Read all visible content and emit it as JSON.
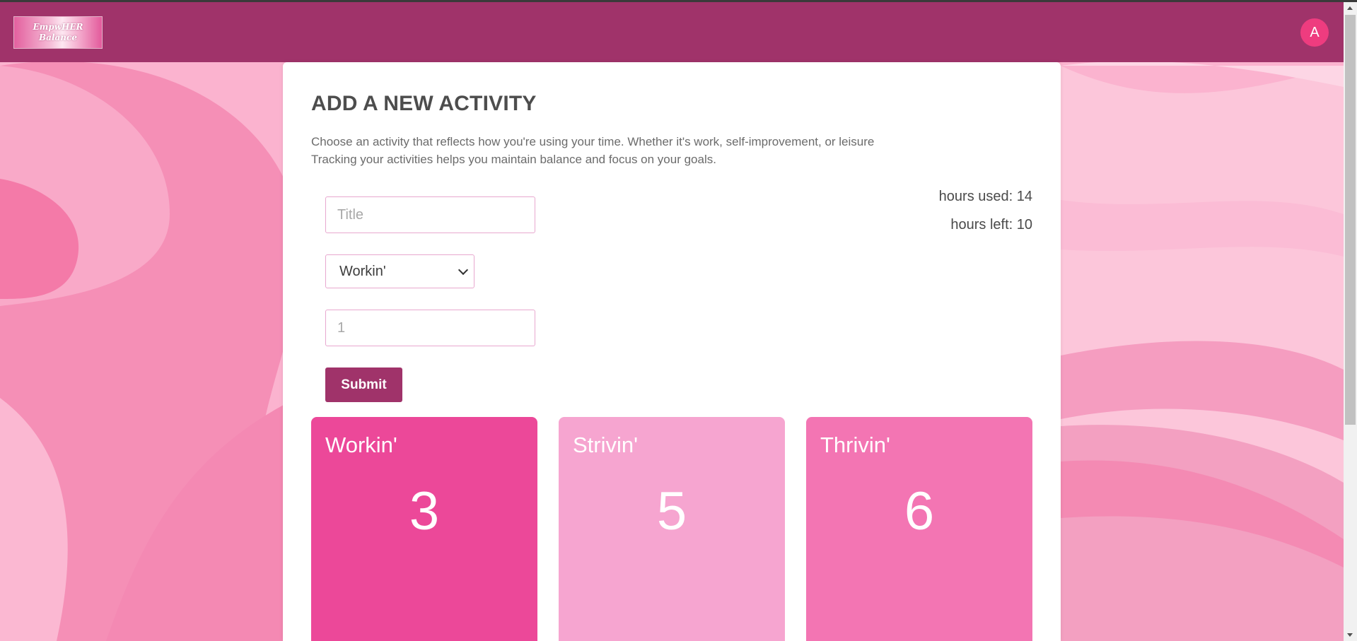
{
  "app": {
    "logo_line1": "EmpwHER",
    "logo_line2": "Balance",
    "avatar_initial": "A",
    "colors": {
      "navbar": "#a0336a",
      "accent": "#ee3c7f",
      "workin_tile": "#ec4899",
      "strivin_tile": "#f6a5d0",
      "thrivin_tile": "#f375b3"
    }
  },
  "form": {
    "title": "ADD A NEW ACTIVITY",
    "description_line1": "Choose an activity that reflects how you're using your time. Whether it's work, self-improvement, or leisure",
    "description_line2": "Tracking your activities helps you maintain balance and focus on your goals.",
    "title_placeholder": "Title",
    "category_selected": "Workin'",
    "hours_placeholder": "1",
    "submit_label": "Submit"
  },
  "stats": {
    "hours_used": "hours used: 14",
    "hours_left": "hours left: 10"
  },
  "categories": [
    {
      "label": "Workin'",
      "value": "3"
    },
    {
      "label": "Strivin'",
      "value": "5"
    },
    {
      "label": "Thrivin'",
      "value": "6"
    }
  ]
}
